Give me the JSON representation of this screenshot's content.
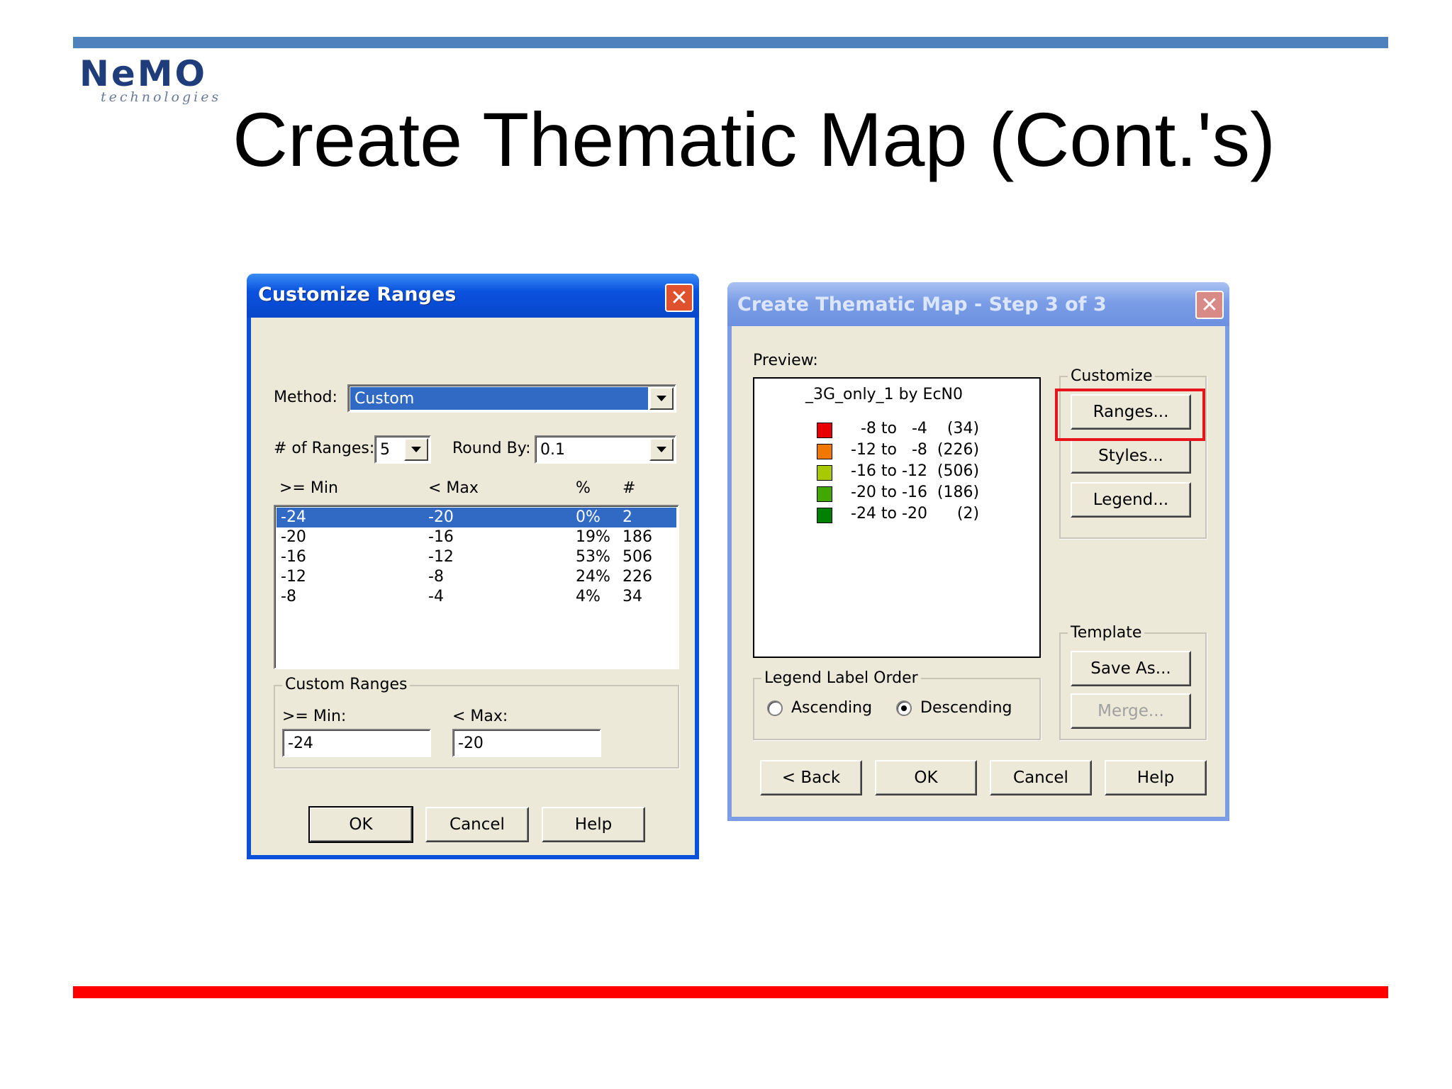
{
  "slide": {
    "title": "Create Thematic Map (Cont.'s)",
    "logo": {
      "word": "NeMO",
      "tagline": "technologies"
    }
  },
  "customize_ranges": {
    "title": "Customize Ranges",
    "method_label": "Method:",
    "method_value": "Custom",
    "num_ranges_label": "# of Ranges:",
    "num_ranges_value": "5",
    "round_by_label": "Round By:",
    "round_by_value": "0.1",
    "columns": [
      ">= Min",
      "< Max",
      "%",
      "#"
    ],
    "rows": [
      {
        "min": "-24",
        "max": "-20",
        "pct": "0%",
        "count": "2",
        "selected": true
      },
      {
        "min": "-20",
        "max": "-16",
        "pct": "19%",
        "count": "186"
      },
      {
        "min": "-16",
        "max": "-12",
        "pct": "53%",
        "count": "506"
      },
      {
        "min": "-12",
        "max": "-8",
        "pct": "24%",
        "count": "226"
      },
      {
        "min": "-8",
        "max": "-4",
        "pct": "4%",
        "count": "34"
      }
    ],
    "custom_ranges_label": "Custom Ranges",
    "min_label": ">= Min:",
    "min_value": "-24",
    "max_label": "< Max:",
    "max_value": "-20",
    "ok": "OK",
    "cancel": "Cancel",
    "help": "Help"
  },
  "thematic_step3": {
    "title": "Create Thematic Map - Step 3 of 3",
    "preview_label": "Preview:",
    "legend_title": "_3G_only_1 by EcN0",
    "legend_items": [
      {
        "text": "  -8 to   -4    (34)",
        "color": "#e80000"
      },
      {
        "text": "-12 to   -8  (226)",
        "color": "#f07800"
      },
      {
        "text": "-16 to -12  (506)",
        "color": "#a8c800"
      },
      {
        "text": "-20 to -16  (186)",
        "color": "#40a800"
      },
      {
        "text": "-24 to -20      (2)",
        "color": "#008000"
      }
    ],
    "customize_label": "Customize",
    "ranges_btn": "Ranges...",
    "styles_btn": "Styles...",
    "legend_btn": "Legend...",
    "template_label": "Template",
    "save_as_btn": "Save As...",
    "merge_btn": "Merge...",
    "legend_order_label": "Legend Label Order",
    "ascending": "Ascending",
    "descending": "Descending",
    "descending_selected": true,
    "back": "< Back",
    "ok": "OK",
    "cancel": "Cancel",
    "help": "Help"
  },
  "colors": {
    "top_bar": "#4f81bd",
    "bottom_bar": "#ff0000",
    "highlight": "#e8141c"
  }
}
